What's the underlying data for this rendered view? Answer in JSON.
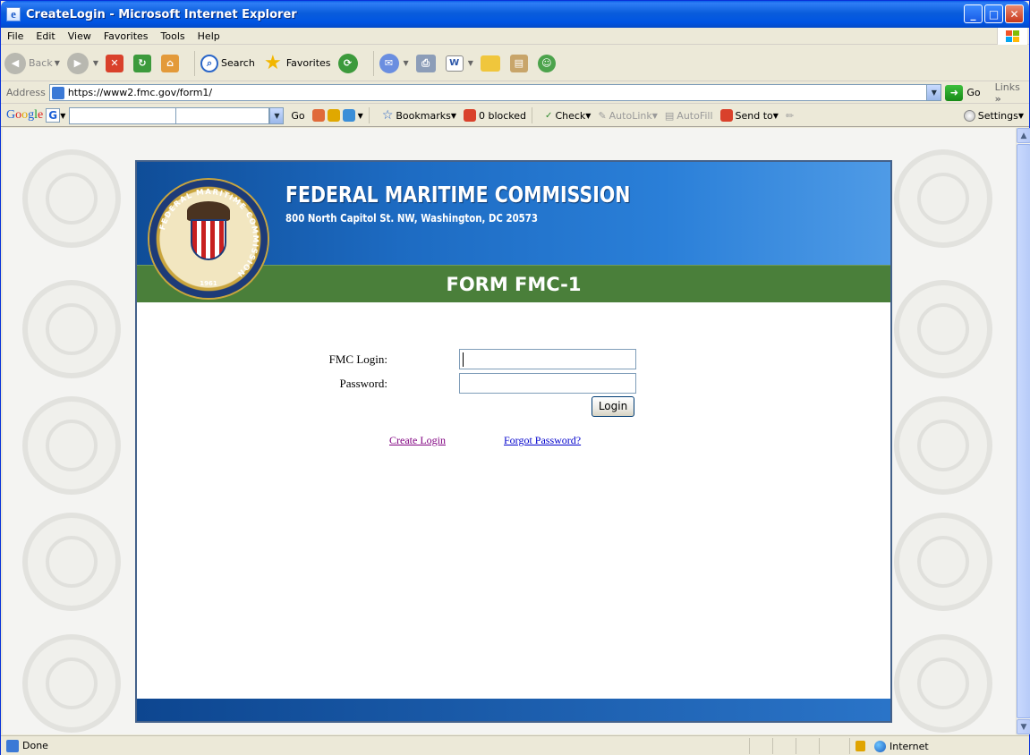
{
  "window": {
    "title": "CreateLogin - Microsoft Internet Explorer",
    "controls": {
      "minimize": "_",
      "maximize": "□",
      "close": "✕"
    }
  },
  "menu": [
    "File",
    "Edit",
    "View",
    "Favorites",
    "Tools",
    "Help"
  ],
  "toolbar": {
    "back": "Back",
    "search": "Search",
    "favorites": "Favorites",
    "icons": [
      "back-icon",
      "forward-icon",
      "stop-icon",
      "refresh-icon",
      "home-icon",
      "search-icon",
      "favorites-star-icon",
      "history-icon",
      "mail-icon",
      "print-icon",
      "word-icon",
      "folder-icon",
      "research-icon",
      "messenger-icon"
    ]
  },
  "addressbar": {
    "label": "Address",
    "url": "https://www2.fmc.gov/form1/",
    "go": "Go",
    "links": "Links",
    "chevron": "»"
  },
  "googlebar": {
    "logo": "Google",
    "go": "Go",
    "bookmarks": "Bookmarks",
    "blocked": "0 blocked",
    "check": "Check",
    "autolink": "AutoLink",
    "autofill": "AutoFill",
    "sendto": "Send to",
    "settings": "Settings"
  },
  "page": {
    "org_name": "FEDERAL MARITIME COMMISSION",
    "address": "800 North Capitol St. NW, Washington, DC 20573",
    "form_title": "FORM FMC-1",
    "seal_text": "FEDERAL MARITIME COMMISSION",
    "seal_year": "1961"
  },
  "login": {
    "login_label": "FMC Login:",
    "login_value": "",
    "password_label": "Password:",
    "password_value": "",
    "submit": "Login",
    "create_link": "Create Login",
    "forgot_link": "Forgot Password?"
  },
  "status": {
    "text": "Done",
    "zone": "Internet"
  },
  "colors": {
    "titlebar": "#0054e3",
    "banner_blue": "#1d6bc2",
    "form_green": "#4a7f3a",
    "visited_link": "#800080",
    "link": "#0000cc"
  }
}
